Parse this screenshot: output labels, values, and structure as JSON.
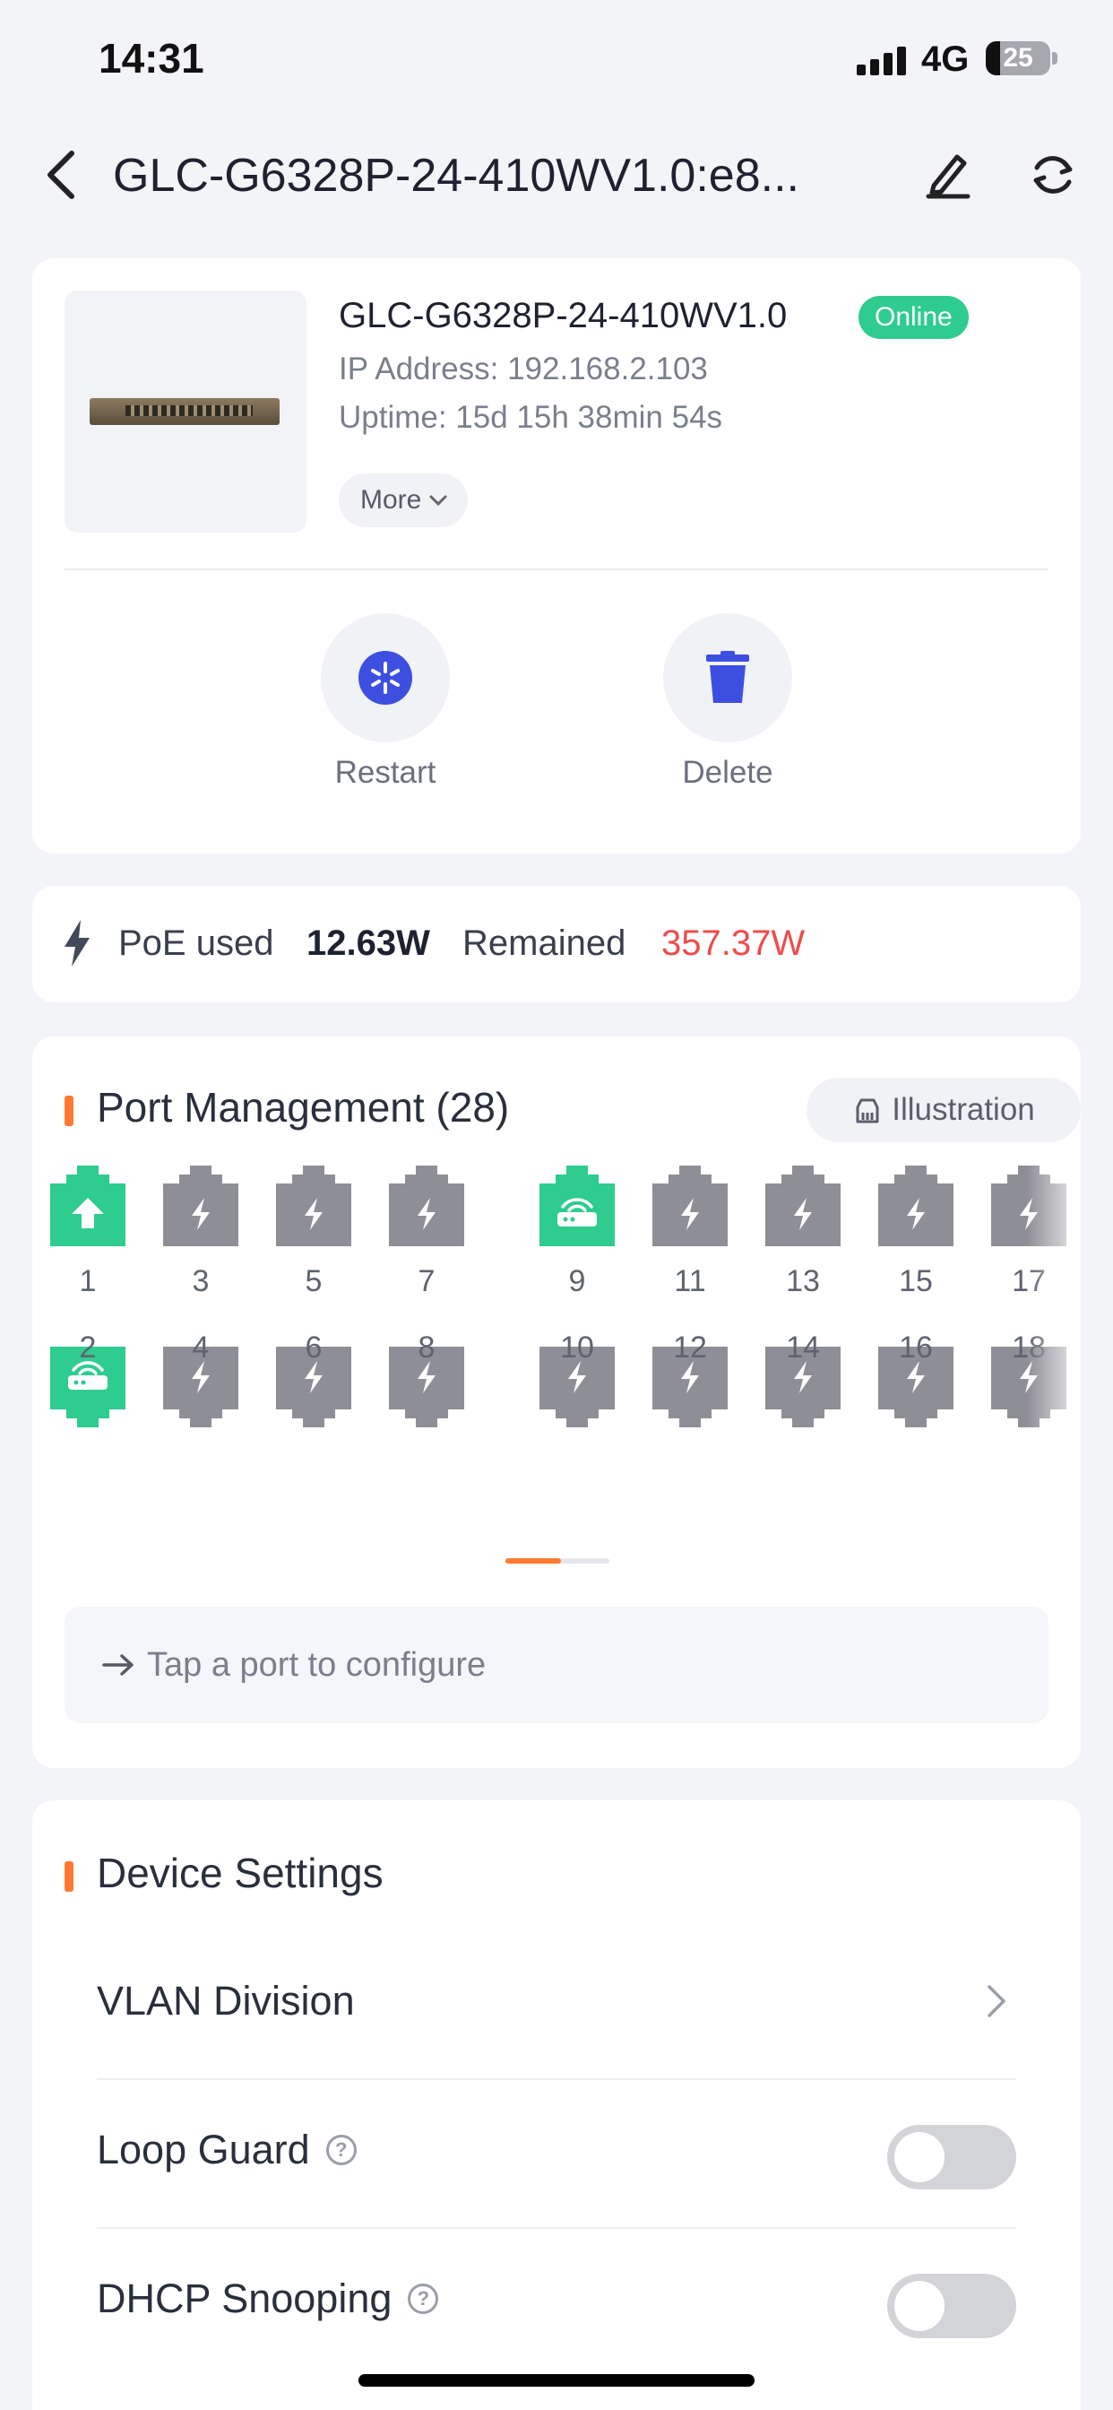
{
  "status_bar": {
    "time": "14:31",
    "network": "4G",
    "battery": "25"
  },
  "header": {
    "title": "GLC-G6328P-24-410WV1.0:e8..."
  },
  "device": {
    "name": "GLC-G6328P-24-410WV1.0",
    "status": "Online",
    "ip": "IP Address: 192.168.2.103",
    "uptime": "Uptime: 15d 15h 38min 54s",
    "more_label": "More",
    "actions": {
      "restart": "Restart",
      "delete": "Delete"
    }
  },
  "poe": {
    "used_label": "PoE used",
    "used_value": "12.63W",
    "remained_label": "Remained",
    "remained_value": "357.37W"
  },
  "ports_section": {
    "title": "Port Management (28)",
    "illustration_label": "Illustration",
    "top_row": [
      {
        "num": "1",
        "state": "uplink"
      },
      {
        "num": "3",
        "state": "poe"
      },
      {
        "num": "5",
        "state": "poe"
      },
      {
        "num": "7",
        "state": "poe"
      },
      {
        "num": "9",
        "state": "connected"
      },
      {
        "num": "11",
        "state": "poe"
      },
      {
        "num": "13",
        "state": "poe"
      },
      {
        "num": "15",
        "state": "poe"
      },
      {
        "num": "17",
        "state": "poe"
      }
    ],
    "bottom_row": [
      {
        "num": "2",
        "state": "connected"
      },
      {
        "num": "4",
        "state": "poe"
      },
      {
        "num": "6",
        "state": "poe"
      },
      {
        "num": "8",
        "state": "poe"
      },
      {
        "num": "10",
        "state": "poe"
      },
      {
        "num": "12",
        "state": "poe"
      },
      {
        "num": "14",
        "state": "poe"
      },
      {
        "num": "16",
        "state": "poe"
      },
      {
        "num": "18",
        "state": "poe"
      }
    ],
    "hint": "Tap a port to configure"
  },
  "settings_section": {
    "title": "Device Settings",
    "items": [
      {
        "label": "VLAN Division",
        "control": "chevron"
      },
      {
        "label": "Loop Guard",
        "control": "toggle",
        "on": false
      },
      {
        "label": "DHCP Snooping",
        "control": "toggle",
        "on": false
      }
    ]
  },
  "colors": {
    "accent": "#FF7A30",
    "online": "#2ECC8F",
    "port_active": "#2ECC8F",
    "port_idle": "#8E8F96",
    "remained": "#F04B4B",
    "icon_blue": "#3D4FE0"
  }
}
